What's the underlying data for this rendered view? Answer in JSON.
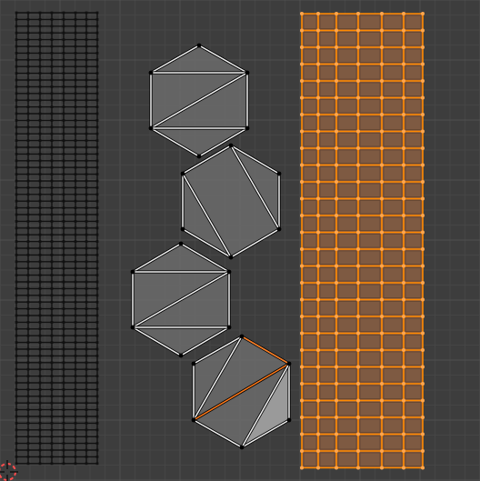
{
  "editor": {
    "type": "UV Editor",
    "colors": {
      "background": "#3d3d3d",
      "grid_minor": "#454545",
      "grid_major": "#505050",
      "mesh_edge": "#111111",
      "mesh_vertex": "#111111",
      "face_fill": "#6b6b6b",
      "selected_face_fill": "#9a9a9a",
      "selected_wire": "#f0f0f0",
      "active_edge": "#ff7a1a",
      "selected_island_fill": "#8a5a3c",
      "selected_island_edge": "#ff8a00",
      "selected_vertex": "#ffa64d",
      "cursor_outer": "#ff4d4d",
      "cursor_inner": "#ffffff"
    }
  },
  "uv_islands": [
    {
      "id": "left-grid",
      "kind": "grid",
      "selected": false
    },
    {
      "id": "hexagon-1",
      "kind": "hexagon",
      "selected": true
    },
    {
      "id": "hexagon-2",
      "kind": "hexagon",
      "selected": true
    },
    {
      "id": "hexagon-3",
      "kind": "hexagon",
      "selected": true
    },
    {
      "id": "hexagon-4",
      "kind": "hexagon",
      "selected": true,
      "active_face": true
    },
    {
      "id": "right-grid",
      "kind": "grid",
      "selected": true
    }
  ],
  "cursor": {
    "icon": "2d-cursor-icon"
  }
}
